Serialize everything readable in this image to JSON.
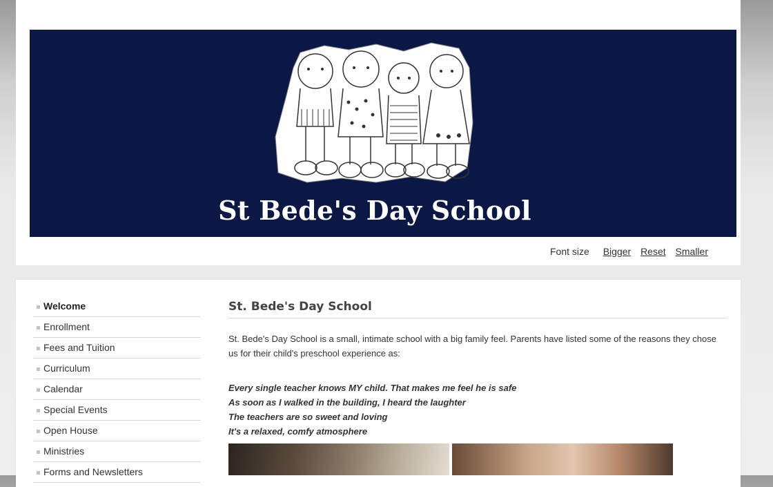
{
  "site": {
    "title": "St Bede's Day School"
  },
  "font_controls": {
    "label": "Font size",
    "bigger": "Bigger",
    "reset": "Reset",
    "smaller": "Smaller"
  },
  "sidebar": {
    "items": [
      {
        "label": "Welcome",
        "active": true
      },
      {
        "label": "Enrollment"
      },
      {
        "label": "Fees and Tuition"
      },
      {
        "label": "Curriculum"
      },
      {
        "label": "Calendar"
      },
      {
        "label": "Special Events"
      },
      {
        "label": "Open House"
      },
      {
        "label": "Ministries"
      },
      {
        "label": "Forms and Newsletters"
      }
    ]
  },
  "main": {
    "heading": "St. Bede's Day School",
    "intro": "St. Bede's Day School is a small, intimate school with a big family feel. Parents have listed some of the reasons they chose us for their child's preschool experience as:",
    "quotes": [
      "Every single teacher knows MY child. That makes me feel he is safe",
      "As soon as I walked in the building, I heard the laughter",
      "The teachers are so sweet and loving",
      "It's a relaxed, comfy atmosphere"
    ]
  },
  "colors": {
    "banner": "#0b1846",
    "text": "#333333"
  }
}
